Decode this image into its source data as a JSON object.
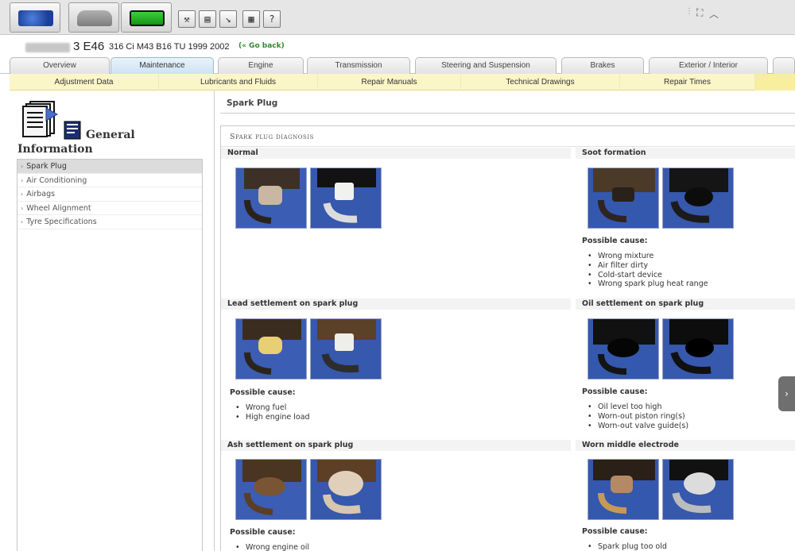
{
  "toolbar": {
    "modules": [
      {
        "name": "module-map-icon",
        "color": "#2a55b5"
      },
      {
        "name": "module-car-icon",
        "color": "#8a8a8a"
      },
      {
        "name": "module-battery-icon",
        "color": "#28b028"
      }
    ],
    "tools": [
      {
        "name": "tools-icon",
        "glyph": "⚒"
      },
      {
        "name": "documents-icon",
        "glyph": "▤"
      },
      {
        "name": "diagram-icon",
        "glyph": "↘"
      },
      {
        "name": "calculator-icon",
        "glyph": "▦"
      },
      {
        "name": "help-icon",
        "glyph": "?"
      }
    ],
    "window_controls": {
      "expand_glyph": "⛶",
      "collapse_glyph": "︿"
    }
  },
  "vehicle": {
    "model": "3 E46",
    "detail": "316 Ci M43 B16 TU 1999 2002",
    "go_back": "(« Go back)"
  },
  "main_tabs": [
    "Overview",
    "Maintenance",
    "Engine",
    "Transmission",
    "Steering and Suspension",
    "Brakes",
    "Exterior / Interior"
  ],
  "active_main_tab": "Maintenance",
  "sub_tabs": [
    "Adjustment Data",
    "Lubricants and Fluids",
    "Repair Manuals",
    "Technical Drawings",
    "Repair Times"
  ],
  "sidebar": {
    "heading_line1": "General",
    "heading_line2": "Information",
    "items": [
      "Spark Plug",
      "Air Conditioning",
      "Airbags",
      "Wheel Alignment",
      "Tyre Specifications"
    ],
    "active_item": "Spark Plug"
  },
  "content": {
    "page_title": "Spark Plug",
    "doc_heading": "Spark plug diagnosis",
    "possible_cause_label": "Possible cause:",
    "sections": [
      {
        "title": "Normal",
        "causes": []
      },
      {
        "title": "Soot formation",
        "causes": [
          "Wrong mixture",
          "Air filter dirty",
          "Cold-start device",
          "Wrong spark plug heat range"
        ]
      },
      {
        "title": "Lead settlement on spark plug",
        "causes": [
          "Wrong fuel",
          "High engine load"
        ]
      },
      {
        "title": "Oil settlement on spark plug",
        "causes": [
          "Oil level too high",
          "Worn-out piston ring(s)",
          "Worn-out valve guide(s)"
        ]
      },
      {
        "title": "Ash settlement on spark plug",
        "causes": [
          "Wrong engine oil"
        ]
      },
      {
        "title": "Worn middle electrode",
        "causes": [
          "Spark plug too old"
        ]
      }
    ]
  },
  "colors": {
    "photo_background": "#3355aa",
    "sub_tab_background": "#fbf6c8",
    "go_back": "#2e8b2e"
  },
  "side_handle_glyph": "›"
}
